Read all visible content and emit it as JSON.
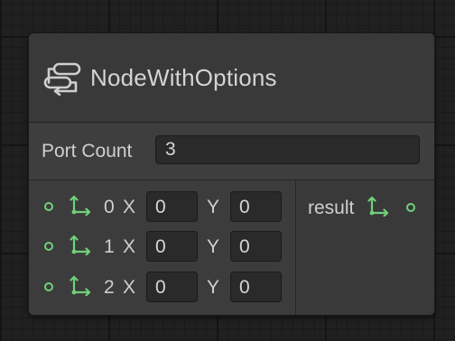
{
  "node": {
    "title": "NodeWithOptions",
    "icon": "node-options-icon",
    "options": {
      "port_count_label": "Port Count",
      "port_count_value": "3"
    },
    "inputs": [
      {
        "index": "0",
        "x_label": "X",
        "x_value": "0",
        "y_label": "Y",
        "y_value": "0",
        "icon": "vector2-icon"
      },
      {
        "index": "1",
        "x_label": "X",
        "x_value": "0",
        "y_label": "Y",
        "y_value": "0",
        "icon": "vector2-icon"
      },
      {
        "index": "2",
        "x_label": "X",
        "x_value": "0",
        "y_label": "Y",
        "y_value": "0",
        "icon": "vector2-icon"
      }
    ],
    "output": {
      "label": "result",
      "icon": "vector2-icon"
    }
  },
  "colors": {
    "port_green": "#6fd17a",
    "background": "#202020",
    "node_body": "#2b2b2b",
    "title_bar": "#393939"
  }
}
